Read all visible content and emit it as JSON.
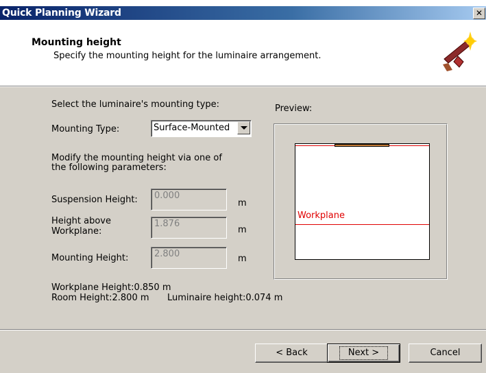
{
  "window": {
    "title": "Quick Planning Wizard",
    "close_glyph": "✕"
  },
  "header": {
    "title": "Mounting height",
    "subtitle": "Specify the mounting height for the luminaire arrangement.",
    "icon": "magic-wand-icon"
  },
  "form": {
    "select_prompt": "Select the luminaire's mounting type:",
    "mounting_type_label": "Mounting Type:",
    "mounting_type_value": "Surface-Mounted",
    "modify_text_line1": "Modify the mounting height via one of",
    "modify_text_line2": "the following parameters:",
    "suspension_label": "Suspension Height:",
    "suspension_value": "0.000",
    "height_above_label_line1": "Height above",
    "height_above_label_line2": "Workplane:",
    "height_above_value": "1.876",
    "mounting_height_label": "Mounting Height:",
    "mounting_height_value": "2.800",
    "unit": "m"
  },
  "info": {
    "workplane_height": "Workplane Height:0.850 m",
    "room_height": "Room Height:2.800 m",
    "luminaire_height": "Luminaire height:0.074 m"
  },
  "preview": {
    "label": "Preview:",
    "workplane_label": "Workplane",
    "line_color": "#e00000",
    "luminaire_color": "#c8803a"
  },
  "buttons": {
    "back": "< Back",
    "next": "Next >",
    "cancel": "Cancel"
  }
}
